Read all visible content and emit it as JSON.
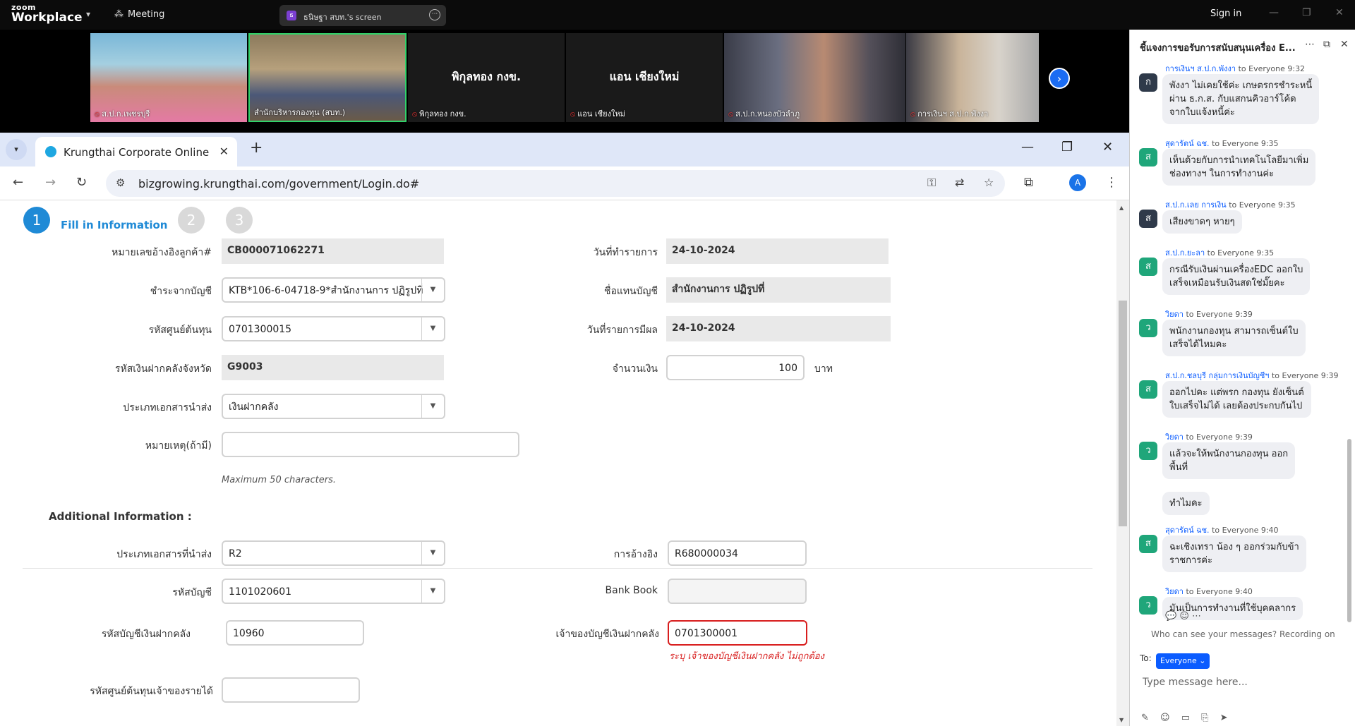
{
  "zoom": {
    "logo_small": "zoom",
    "logo_big": "Workplace",
    "meeting_label": "Meeting",
    "share_label": "ธนิษฐา สบท.'s screen",
    "signin": "Sign in"
  },
  "videos": [
    {
      "name": "ส.ป.ก.เพชรบุรี"
    },
    {
      "name": "สำนักบริหารกองทุน (สบท.)"
    },
    {
      "name": "พิกุลทอง กงข.",
      "big": "พิกุลทอง กงข."
    },
    {
      "name": "แอน เชียงใหม่",
      "big": "แอน เชียงใหม่"
    },
    {
      "name": "ส.ป.ก.หนองบัวลำภู"
    },
    {
      "name": "การเงินฯ ส.ป.ก.พังงา"
    }
  ],
  "browser": {
    "tab_title": "Krungthai Corporate Online",
    "url": "bizgrowing.krungthai.com/government/Login.do#",
    "profile_initial": "A"
  },
  "steps": {
    "s1": "1",
    "s2": "2",
    "s3": "3",
    "label": "Fill in Information"
  },
  "form": {
    "ref_label": "หมายเลขอ้างอิงลูกค้า#",
    "ref_value": "CB000071062271",
    "txdate_label": "วันที่ทำรายการ",
    "txdate_value": "24-10-2024",
    "account_label": "ชำระจากบัญชี",
    "account_value": "KTB*106-6-04718-9*สำนักงานการ ปฏิรูปที่",
    "acctname_label": "ชื่อแทนบัญชี",
    "acctname_value": "สำนักงานการ ปฏิรูปที่",
    "costcenter_label": "รหัสศูนย์ต้นทุน",
    "costcenter_value": "0701300015",
    "effdate_label": "วันที่รายการมีผล",
    "effdate_value": "24-10-2024",
    "deposit_label": "รหัสเงินฝากคลังจังหวัด",
    "deposit_value": "G9003",
    "amount_label": "จำนวนเงิน",
    "amount_value": "100",
    "currency": "บาท",
    "doctype_label": "ประเภทเอกสารนำส่ง",
    "doctype_value": "เงินฝากคลัง",
    "note_label": "หมายเหตุ(ถ้ามี)",
    "note_value": "",
    "note_hint": "Maximum 50 characters."
  },
  "additional": {
    "heading": "Additional Information :",
    "doctype2_label": "ประเภทเอกสารที่นำส่ง",
    "doctype2_value": "R2",
    "refno_label": "การอ้างอิง",
    "refno_value": "R680000034",
    "acctcode_label": "รหัสบัญชี",
    "acctcode_value": "1101020601",
    "bankbook_label": "Bank Book",
    "bankbook_value": "",
    "depacct_label": "รหัสบัญชีเงินฝากคลัง",
    "depacct_value": "10960",
    "owner_label": "เจ้าของบัญชีเงินฝากคลัง",
    "owner_value": "0701300001",
    "owner_error": "ระบุ เจ้าของบัญชีเงินฝากคลัง ไม่ถูกต้อง",
    "revcenter_label": "รหัสศูนย์ต้นทุนเจ้าของรายได้",
    "revcenter_value": ""
  },
  "chat": {
    "title": "ชี้แจงการขอรับการสนับสนุนเครื่อง E...",
    "messages": [
      {
        "from": "การเงินฯ ส.ป.ก.พังงา",
        "to": "to Everyone",
        "time": "9:32",
        "initial": "ก",
        "color": "#2f3a4a",
        "lines": [
          "พังงา ไม่เคยใช้ค่ะ เกษตรกรชำระหนี้",
          "ผ่าน ธ.ก.ส. กับแสกนคิวอาร์โค้ด",
          "จากใบแจ้งหนี้ค่ะ"
        ]
      },
      {
        "from": "สุดารัตน์ ฉช.",
        "to": "to Everyone",
        "time": "9:35",
        "initial": "ส",
        "color": "#1fa67a",
        "lines": [
          "เห็นด้วยกับการนำเทคโนโลยีมาเพิ่ม",
          "ช่องทางฯ ในการทำงานค่ะ"
        ]
      },
      {
        "from": "ส.ป.ก.เลย การเงิน",
        "to": "to Everyone",
        "time": "9:35",
        "initial": "ส",
        "color": "#2f3a4a",
        "lines": [
          "เสียงขาดๆ หายๆ"
        ]
      },
      {
        "from": "ส.ป.ก.ยะลา",
        "to": "to Everyone",
        "time": "9:35",
        "initial": "ส",
        "color": "#1fa67a",
        "lines": [
          "กรณีรับเงินผ่านเครื่องEDC ออกใบ",
          "เสร็จเหมือนรับเงินสดใช่มั๊ยคะ"
        ]
      },
      {
        "from": "วิยดา",
        "to": "to Everyone",
        "time": "9:39",
        "initial": "ว",
        "color": "#1fa67a",
        "lines": [
          "พนักงานกองทุน สามารถเซ็นต์ใบ",
          "เสร็จได้ไหมคะ"
        ]
      },
      {
        "from": "ส.ป.ก.ชลบุรี กลุ่มการเงินบัญชีฯ",
        "to": "to Everyone",
        "time": "9:39",
        "initial": "ส",
        "color": "#1fa67a",
        "lines": [
          "ออกไปคะ แต่พรก กองทุน ยังเซ็นต์",
          "ใบเสร็จไม่ได้ เลยต้องประกบกันไป"
        ]
      },
      {
        "from": "วิยดา",
        "to": "to Everyone",
        "time": "9:39",
        "initial": "ว",
        "color": "#1fa67a",
        "lines": [
          "แล้วจะให้พนักงานกองทุน ออก",
          "พื้นที่"
        ],
        "extra": "ทำไมคะ"
      },
      {
        "from": "สุดารัตน์ ฉช.",
        "to": "to Everyone",
        "time": "9:40",
        "initial": "ส",
        "color": "#1fa67a",
        "lines": [
          "ฉะเชิงเทรา น้อง ๆ  ออกร่วมกับข้า",
          "ราชการค่ะ"
        ]
      },
      {
        "from": "วิยดา",
        "to": "to Everyone",
        "time": "9:40",
        "initial": "ว",
        "color": "#1fa67a",
        "lines": [
          "มันเป็นการทำงานที่ใช้บุคคลากร"
        ]
      }
    ],
    "who_can_see": "Who can see your messages? Recording on",
    "to_label": "To:",
    "to_value": "Everyone ⌄",
    "placeholder": "Type message here..."
  }
}
